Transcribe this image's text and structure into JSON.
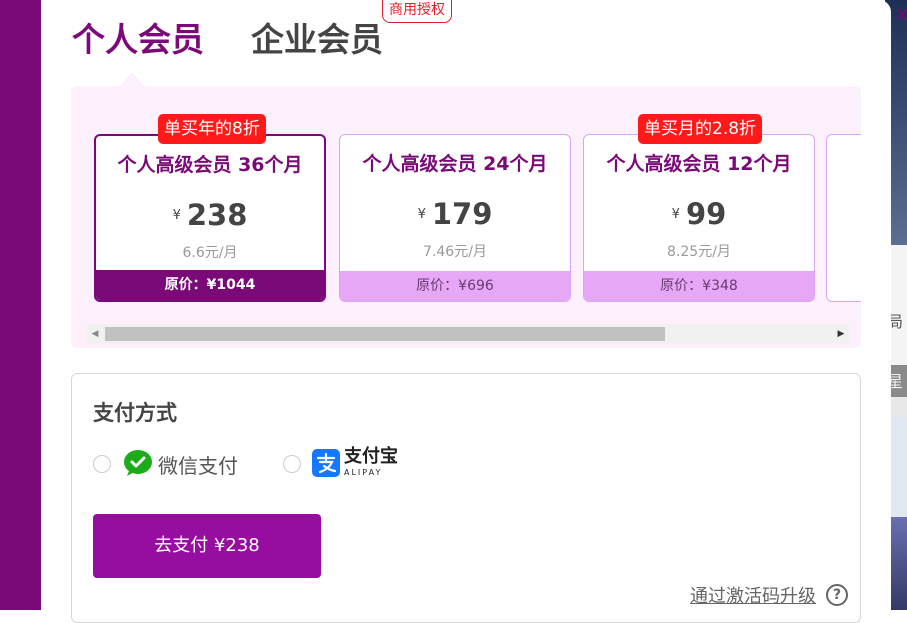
{
  "tabs": {
    "personal": "个人会员",
    "enterprise": "企业会员",
    "commercial_badge": "商用授权"
  },
  "plans": [
    {
      "name": "个人高级会员 36个月",
      "currency": "¥",
      "price": "238",
      "monthly": "6.6元/月",
      "original": "原价：¥1044",
      "promo": "单买年的8折",
      "selected": true
    },
    {
      "name": "个人高级会员 24个月",
      "currency": "¥",
      "price": "179",
      "monthly": "7.46元/月",
      "original": "原价：¥696",
      "promo": "",
      "selected": false
    },
    {
      "name": "个人高级会员 12个月",
      "currency": "¥",
      "price": "99",
      "monthly": "8.25元/月",
      "original": "原价：¥348",
      "promo": "单买月的2.8折",
      "selected": false
    }
  ],
  "payment": {
    "title": "支付方式",
    "wechat_label": "微信支付",
    "alipay_label": "支付宝",
    "alipay_sub": "ALIPAY",
    "pay_button": "去支付  ¥238",
    "activation_link": "通过激活码升级",
    "help": "?"
  },
  "close": "×",
  "background": {
    "fragment_1": "局",
    "fragment_2": "星"
  },
  "colors": {
    "brand": "#7a0a78",
    "pay_button": "#960da0",
    "promo": "#ff1a1a",
    "card_footer": "#e6a8f6",
    "panel_bg": "#fbf0fc"
  }
}
